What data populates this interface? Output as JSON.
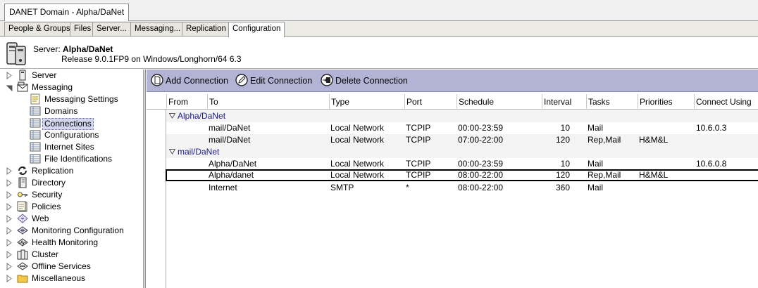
{
  "window_tab": "DANET Domain - Alpha/DaNet",
  "view_tabs": [
    "People & Groups",
    "Files",
    "Server...",
    "Messaging...",
    "Replication",
    "Configuration"
  ],
  "server": {
    "label": "Server:",
    "name": "Alpha/DaNet",
    "release": "Release 9.0.1FP9 on Windows/Longhorn/64 6.3"
  },
  "tree": [
    {
      "label": "Server",
      "icon": "server-icon"
    },
    {
      "label": "Messaging",
      "icon": "mail-icon"
    },
    {
      "label": "Messaging Settings",
      "icon": "settings-doc-icon"
    },
    {
      "label": "Domains",
      "icon": "view-icon"
    },
    {
      "label": "Connections",
      "icon": "view-icon"
    },
    {
      "label": "Configurations",
      "icon": "view-icon"
    },
    {
      "label": "Internet Sites",
      "icon": "view-icon"
    },
    {
      "label": "File Identifications",
      "icon": "view-icon"
    },
    {
      "label": "Replication",
      "icon": "replication-icon"
    },
    {
      "label": "Directory",
      "icon": "directory-icon"
    },
    {
      "label": "Security",
      "icon": "key-icon"
    },
    {
      "label": "Policies",
      "icon": "policies-icon"
    },
    {
      "label": "Web",
      "icon": "web-icon"
    },
    {
      "label": "Monitoring Configuration",
      "icon": "monitoring-icon"
    },
    {
      "label": "Health Monitoring",
      "icon": "health-icon"
    },
    {
      "label": "Cluster",
      "icon": "cluster-icon"
    },
    {
      "label": "Offline Services",
      "icon": "offline-icon"
    },
    {
      "label": "Miscellaneous",
      "icon": "folder-icon"
    }
  ],
  "actions": {
    "add": "Add Connection",
    "edit": "Edit Connection",
    "delete": "Delete Connection"
  },
  "columns": [
    "From",
    "To",
    "Type",
    "Port",
    "Schedule",
    "Interval",
    "Tasks",
    "Priorities",
    "Connect Using"
  ],
  "groups": [
    {
      "name": "Alpha/DaNet",
      "rows": [
        {
          "to": "mail/DaNet",
          "type": "Local Network",
          "port": "TCPIP",
          "schedule": "00:00-23:59",
          "interval": "10",
          "tasks": "Mail",
          "priorities": "",
          "connect": "10.6.0.3"
        },
        {
          "to": "mail/DaNet",
          "type": "Local Network",
          "port": "TCPIP",
          "schedule": "07:00-22:00",
          "interval": "120",
          "tasks": "Rep,Mail",
          "priorities": "H&M&L",
          "connect": ""
        }
      ]
    },
    {
      "name": "mail/DaNet",
      "rows": [
        {
          "to": "Alpha/DaNet",
          "type": "Local Network",
          "port": "TCPIP",
          "schedule": "00:00-23:59",
          "interval": "10",
          "tasks": "Mail",
          "priorities": "",
          "connect": "10.6.0.8"
        },
        {
          "to": "Alpha/danet",
          "type": "Local Network",
          "port": "TCPIP",
          "schedule": "08:00-22:00",
          "interval": "120",
          "tasks": "Rep,Mail",
          "priorities": "H&M&L",
          "connect": ""
        },
        {
          "to": "Internet",
          "type": "SMTP",
          "port": "*",
          "schedule": "08:00-22:00",
          "interval": "360",
          "tasks": "Mail",
          "priorities": "",
          "connect": ""
        }
      ]
    }
  ]
}
